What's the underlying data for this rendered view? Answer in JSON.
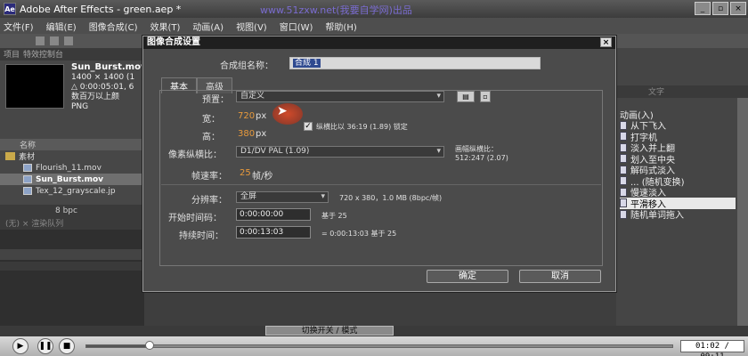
{
  "window": {
    "title": "Adobe After Effects - green.aep *",
    "watermark": "www.51zxw.net(我要自学网)出品"
  },
  "menu": [
    "文件(F)",
    "编辑(E)",
    "图像合成(C)",
    "效果(T)",
    "动画(A)",
    "视图(V)",
    "窗口(W)",
    "帮助(H)"
  ],
  "project": {
    "tabs": [
      "项目",
      "特效控制台"
    ],
    "file_name": "Sun_Burst.mov",
    "file_info": [
      "1400 × 1400 (1",
      "△ 0:00:05:01, 6",
      "数百万以上颜",
      "PNG"
    ],
    "column_name": "名称",
    "items": [
      {
        "label": "素材",
        "type": "folder",
        "indent": false,
        "selected": false
      },
      {
        "label": "Flourish_11.mov",
        "type": "file",
        "indent": true,
        "selected": false
      },
      {
        "label": "Sun_Burst.mov",
        "type": "file",
        "indent": true,
        "selected": true
      },
      {
        "label": "Tex_12_grayscale.jp",
        "type": "file",
        "indent": true,
        "selected": false
      }
    ],
    "bpc": "8 bpc"
  },
  "timeline": {
    "tab": "(无) × 渲染队列",
    "col": "图"
  },
  "effects_panel": {
    "tab": "文字",
    "items": [
      {
        "label": "动画(入)",
        "selected": false
      },
      {
        "label": "从下飞入",
        "selected": false
      },
      {
        "label": "打字机",
        "selected": false
      },
      {
        "label": "淡入并上翻",
        "selected": false
      },
      {
        "label": "划入至中央",
        "selected": false
      },
      {
        "label": "解码式淡入",
        "selected": false
      },
      {
        "label": "... (随机变换)",
        "selected": false
      },
      {
        "label": "慢速淡入",
        "selected": false
      },
      {
        "label": "平滑移入",
        "selected": true
      },
      {
        "label": "随机单词拖入",
        "selected": false
      }
    ]
  },
  "dialog": {
    "title": "图像合成设置",
    "close": "×",
    "name_label": "合成组名称：",
    "name_value": "合成 1",
    "tabs": [
      "基本",
      "高级"
    ],
    "preset_label": "预置：",
    "preset_value": "自定义",
    "width_label": "宽：",
    "width_value": "720",
    "height_label": "高：",
    "height_value": "380",
    "unit_px": "px",
    "lock_label": "纵横比以 36:19 (1.89) 锁定",
    "pixel_aspect_label": "像素纵横比：",
    "pixel_aspect_value": "D1/DV PAL (1.09)",
    "frame_aspect_label": "画幅纵横比：",
    "frame_aspect_value": "512:247 (2.07)",
    "fps_label": "帧速率：",
    "fps_value": "25",
    "fps_unit": "帧/秒",
    "resolution_label": "分辨率：",
    "resolution_value": "全屏",
    "resolution_info": "720 x 380，1.0 MB (8bpc/帧)",
    "start_label": "开始时间码：",
    "start_value": "0:00:00:00",
    "start_base": "基于 25",
    "duration_label": "持续时间：",
    "duration_value": "0:00:13:03",
    "duration_info": "= 0:00:13:03  基于 25",
    "ok": "确定",
    "cancel": "取消"
  },
  "toggle_label": "切换开关 / 模式",
  "player": {
    "time": "01:02 / 09:11",
    "progress": 0.11
  }
}
